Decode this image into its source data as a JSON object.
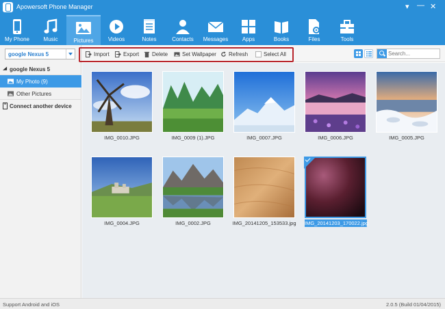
{
  "app": {
    "title": "Apowersoft Phone Manager"
  },
  "nav": [
    {
      "label": "My Phone",
      "icon": "phone-icon"
    },
    {
      "label": "Music",
      "icon": "music-note-icon"
    },
    {
      "label": "Pictures",
      "icon": "picture-icon",
      "active": true
    },
    {
      "label": "Videos",
      "icon": "play-icon"
    },
    {
      "label": "Notes",
      "icon": "notes-icon"
    },
    {
      "label": "Contacts",
      "icon": "contact-icon"
    },
    {
      "label": "Messages",
      "icon": "envelope-icon"
    },
    {
      "label": "Apps",
      "icon": "apps-grid-icon"
    },
    {
      "label": "Books",
      "icon": "book-icon"
    },
    {
      "label": "Files",
      "icon": "file-gear-icon"
    },
    {
      "label": "Tools",
      "icon": "toolbox-icon"
    }
  ],
  "sidebar": {
    "device_select": "google Nexus 5",
    "device_name": "google Nexus 5",
    "items": [
      {
        "label": "My Photo (9)",
        "selected": true
      },
      {
        "label": "Other Pictures",
        "selected": false
      }
    ],
    "connect": "Connect another device"
  },
  "toolbar": {
    "import": "Import",
    "export": "Export",
    "delete": "Delete",
    "set_wallpaper": "Set Wallpaper",
    "refresh": "Refresh",
    "select_all": "Select All"
  },
  "search": {
    "placeholder": "Search..."
  },
  "photos": [
    {
      "name": "IMG_0010.JPG",
      "scene": "windmill"
    },
    {
      "name": "IMG_0009 (1).JPG",
      "scene": "green-hills"
    },
    {
      "name": "IMG_0007.JPG",
      "scene": "snowy-mountain"
    },
    {
      "name": "IMG_0006.JPG",
      "scene": "lake-flowers"
    },
    {
      "name": "IMG_0005.JPG",
      "scene": "frozen-shore"
    },
    {
      "name": "IMG_0004.JPG",
      "scene": "castle-hill"
    },
    {
      "name": "IMG_0002.JPG",
      "scene": "mountain-lake"
    },
    {
      "name": "IMG_20141205_153533.jpg",
      "scene": "wood-texture"
    },
    {
      "name": "IMG_20141203_170022.jpg",
      "scene": "dark-red",
      "selected": true
    }
  ],
  "status": {
    "left": "Support Android and iOS",
    "right": "2.0.5 (Build 01/04/2015)"
  },
  "colors": {
    "accent": "#2a8fd8",
    "selection": "#3d9ae6",
    "highlight_frame": "#b8252c"
  }
}
